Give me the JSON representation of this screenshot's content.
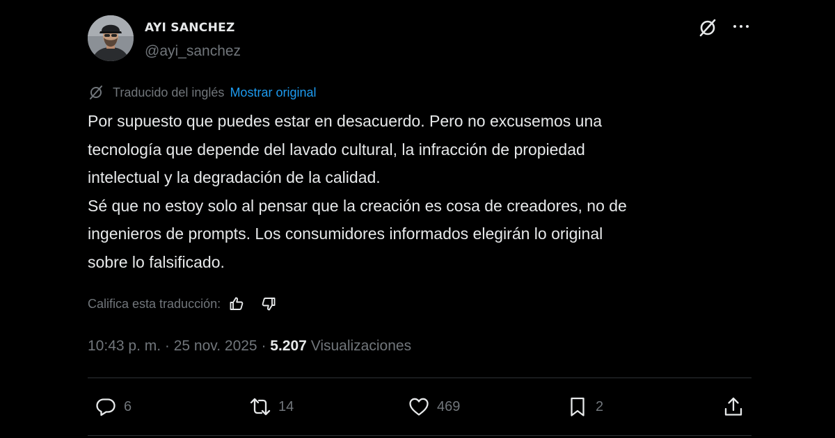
{
  "author": {
    "name": "AYI SANCHEZ",
    "handle": "@ayi_sanchez"
  },
  "header_icons": {
    "translate": "grok-slash-icon",
    "more": "more-icon"
  },
  "translation": {
    "label": "Traducido del inglés",
    "show_original": "Mostrar original"
  },
  "tweet": {
    "lines": [
      "Por supuesto que puedes estar en desacuerdo. Pero no excusemos una",
      "tecnología que depende del lavado cultural, la infracción de propiedad",
      "intelectual y la degradación de la calidad.",
      "Sé que no estoy solo al pensar que la creación es cosa de creadores, no de",
      "ingenieros de prompts. Los consumidores informados elegirán lo original",
      "sobre lo falsificado."
    ]
  },
  "rating": {
    "label": "Califica esta traducción:"
  },
  "meta": {
    "time": "10:43 p. m.",
    "separator": " · ",
    "date": "25 nov. 2025",
    "views_count": "5.207",
    "views_label": "Visualizaciones"
  },
  "actions": {
    "replies": "6",
    "reposts": "14",
    "likes": "469",
    "bookmarks": "2"
  },
  "colors": {
    "background": "#000000",
    "text": "#e7e9ea",
    "secondary": "#71767b",
    "link": "#1d9bf0",
    "divider": "#2f3336"
  }
}
